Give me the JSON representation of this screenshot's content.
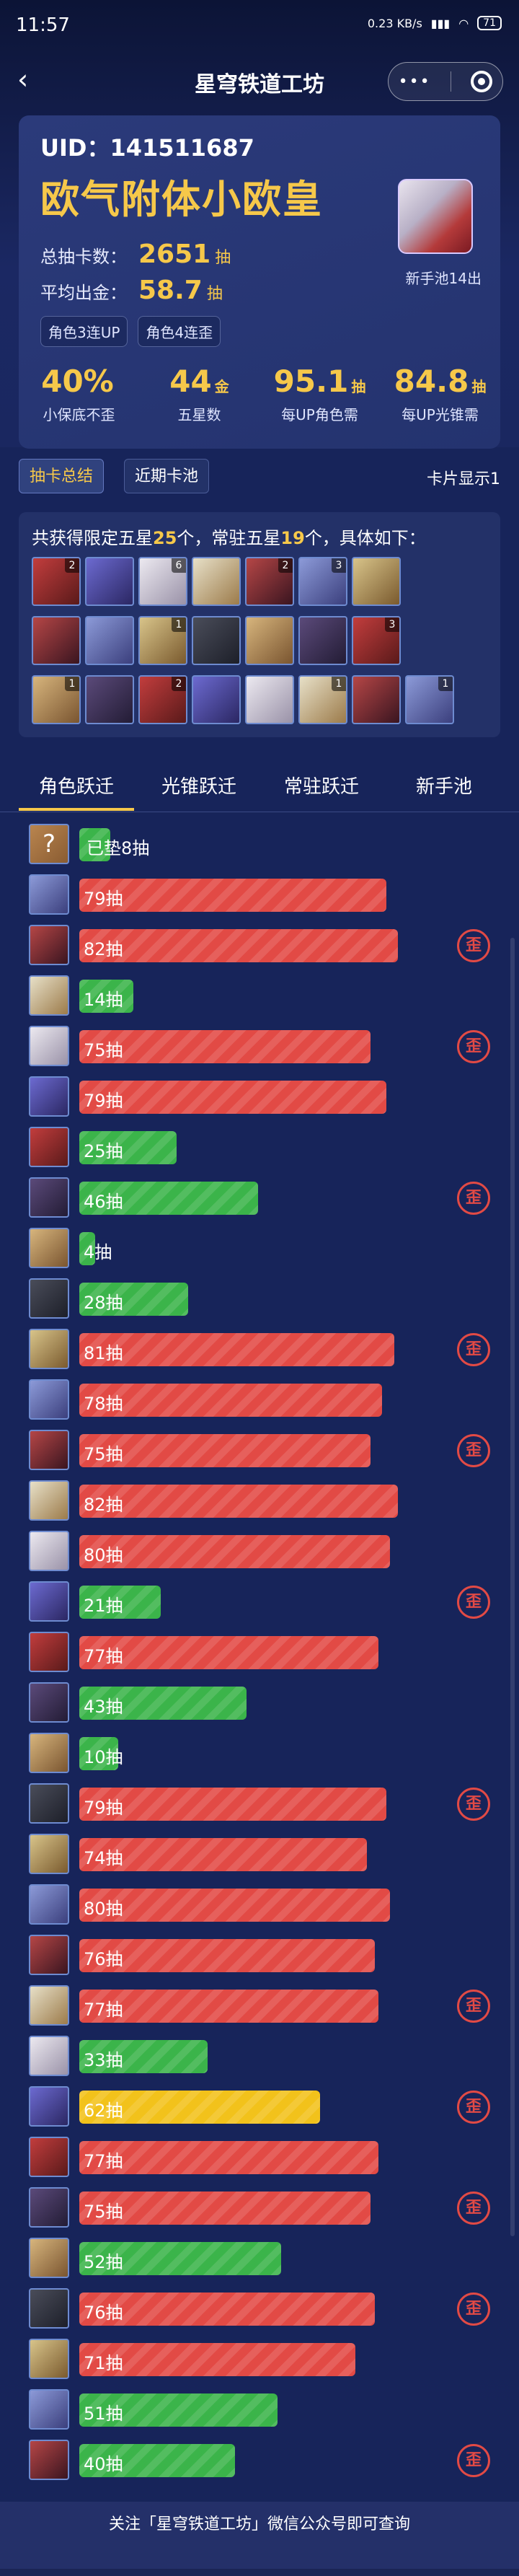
{
  "status": {
    "time": "11:57",
    "net": "0.23 KB/s",
    "battery": "71"
  },
  "nav": {
    "title": "星穹铁道工坊",
    "more": "•••"
  },
  "profile": {
    "uid": "UID：141511687",
    "title": "欧气附体小欧皇",
    "total_label": "总抽卡数：",
    "total_value": "2651",
    "avg_label": "平均出金：",
    "avg_value": "58.7",
    "unit": "抽",
    "tag1": "角色3连UP",
    "tag2": "角色4连歪",
    "avatar_caption": "新手池14出"
  },
  "metrics": [
    {
      "value": "40%",
      "unit": "",
      "label": "小保底不歪"
    },
    {
      "value": "44",
      "unit": "金",
      "label": "五星数"
    },
    {
      "value": "95.1",
      "unit": "抽",
      "label": "每UP角色需"
    },
    {
      "value": "84.8",
      "unit": "抽",
      "label": "每UP光锥需"
    }
  ],
  "top_tabs": {
    "summary": "抽卡总结",
    "recent": "近期卡池",
    "display": "卡片显示1"
  },
  "pool": {
    "text_prefix": "共获得限定五星",
    "limited": "25",
    "mid": "个，常驻五星",
    "standard": "19",
    "suffix": "个，具体如下："
  },
  "thumbs_row1": [
    "2",
    "",
    "6",
    "",
    "2",
    "3",
    ""
  ],
  "thumbs_row2": [
    "",
    "",
    "1",
    "",
    "",
    "",
    "3"
  ],
  "thumbs_row3": [
    "1",
    "",
    "2",
    "",
    "",
    "1",
    "",
    "1"
  ],
  "bottom_tabs": [
    "角色跃迁",
    "光锥跃迁",
    "常驻跃迁",
    "新手池"
  ],
  "miss_label": "歪",
  "pulls": [
    {
      "label": "已垫8抽",
      "value": 8,
      "color": "green",
      "miss": false
    },
    {
      "label": "79抽",
      "value": 79,
      "color": "red",
      "miss": false
    },
    {
      "label": "82抽",
      "value": 82,
      "color": "red",
      "miss": true
    },
    {
      "label": "14抽",
      "value": 14,
      "color": "green",
      "miss": false
    },
    {
      "label": "75抽",
      "value": 75,
      "color": "red",
      "miss": true
    },
    {
      "label": "79抽",
      "value": 79,
      "color": "red",
      "miss": false
    },
    {
      "label": "25抽",
      "value": 25,
      "color": "green",
      "miss": false
    },
    {
      "label": "46抽",
      "value": 46,
      "color": "green",
      "miss": true
    },
    {
      "label": "4抽",
      "value": 4,
      "color": "green",
      "miss": false
    },
    {
      "label": "28抽",
      "value": 28,
      "color": "green",
      "miss": false
    },
    {
      "label": "81抽",
      "value": 81,
      "color": "red",
      "miss": true
    },
    {
      "label": "78抽",
      "value": 78,
      "color": "red",
      "miss": false
    },
    {
      "label": "75抽",
      "value": 75,
      "color": "red",
      "miss": true
    },
    {
      "label": "82抽",
      "value": 82,
      "color": "red",
      "miss": false
    },
    {
      "label": "80抽",
      "value": 80,
      "color": "red",
      "miss": false
    },
    {
      "label": "21抽",
      "value": 21,
      "color": "green",
      "miss": true
    },
    {
      "label": "77抽",
      "value": 77,
      "color": "red",
      "miss": false
    },
    {
      "label": "43抽",
      "value": 43,
      "color": "green",
      "miss": false
    },
    {
      "label": "10抽",
      "value": 10,
      "color": "green",
      "miss": false
    },
    {
      "label": "79抽",
      "value": 79,
      "color": "red",
      "miss": true
    },
    {
      "label": "74抽",
      "value": 74,
      "color": "red",
      "miss": false
    },
    {
      "label": "80抽",
      "value": 80,
      "color": "red",
      "miss": false
    },
    {
      "label": "76抽",
      "value": 76,
      "color": "red",
      "miss": false
    },
    {
      "label": "77抽",
      "value": 77,
      "color": "red",
      "miss": true
    },
    {
      "label": "33抽",
      "value": 33,
      "color": "green",
      "miss": false
    },
    {
      "label": "62抽",
      "value": 62,
      "color": "gold",
      "miss": true
    },
    {
      "label": "77抽",
      "value": 77,
      "color": "red",
      "miss": false
    },
    {
      "label": "75抽",
      "value": 75,
      "color": "red",
      "miss": true
    },
    {
      "label": "52抽",
      "value": 52,
      "color": "green",
      "miss": false
    },
    {
      "label": "76抽",
      "value": 76,
      "color": "red",
      "miss": true
    },
    {
      "label": "71抽",
      "value": 71,
      "color": "red",
      "miss": false
    },
    {
      "label": "51抽",
      "value": 51,
      "color": "green",
      "miss": false
    },
    {
      "label": "40抽",
      "value": 40,
      "color": "green",
      "miss": true
    }
  ],
  "footer": "关注「星穹铁道工坊」微信公众号即可查询",
  "colors": {
    "accent_gold": "#f6c84a",
    "bar_red": "#e24a45",
    "bar_green": "#3bb44a",
    "bar_gold": "#f2c21b",
    "background": "#17245a"
  }
}
